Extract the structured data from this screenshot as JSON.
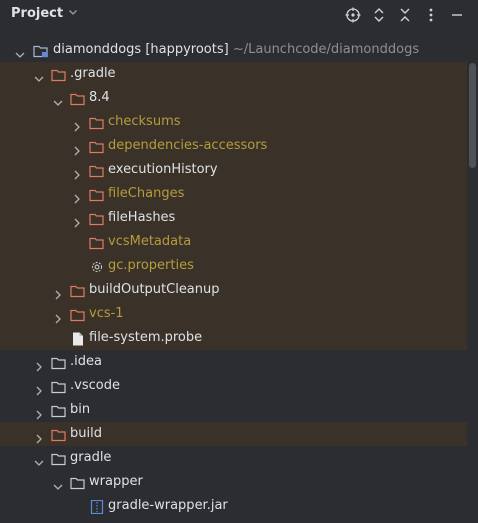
{
  "header": {
    "title": "Project",
    "icons": [
      "crosshair-icon",
      "expand-all-icon",
      "collapse-all-icon",
      "more-options-icon",
      "minimize-icon"
    ]
  },
  "tree": {
    "root": {
      "name": "diamonddogs",
      "branch": "[happyroots]",
      "path": "~/Launchcode/diamonddogs"
    },
    "gradle_dir": ".gradle",
    "version_dir": "8.4",
    "checksums": "checksums",
    "dependencies_accessors": "dependencies-accessors",
    "execution_history": "executionHistory",
    "file_changes": "fileChanges",
    "file_hashes": "fileHashes",
    "vcs_metadata": "vcsMetadata",
    "gc_properties": "gc.properties",
    "build_output_cleanup": "buildOutputCleanup",
    "vcs_1": "vcs-1",
    "file_system_probe": "file-system.probe",
    "idea": ".idea",
    "vscode": ".vscode",
    "bin": "bin",
    "build": "build",
    "gradle": "gradle",
    "wrapper": "wrapper",
    "gradle_wrapper_jar": "gradle-wrapper.jar"
  },
  "colors": {
    "background": "#2b2d30",
    "ignored_row": "#3a3228",
    "ignored_text": "#b59c3e",
    "text": "#dfe1e5"
  }
}
